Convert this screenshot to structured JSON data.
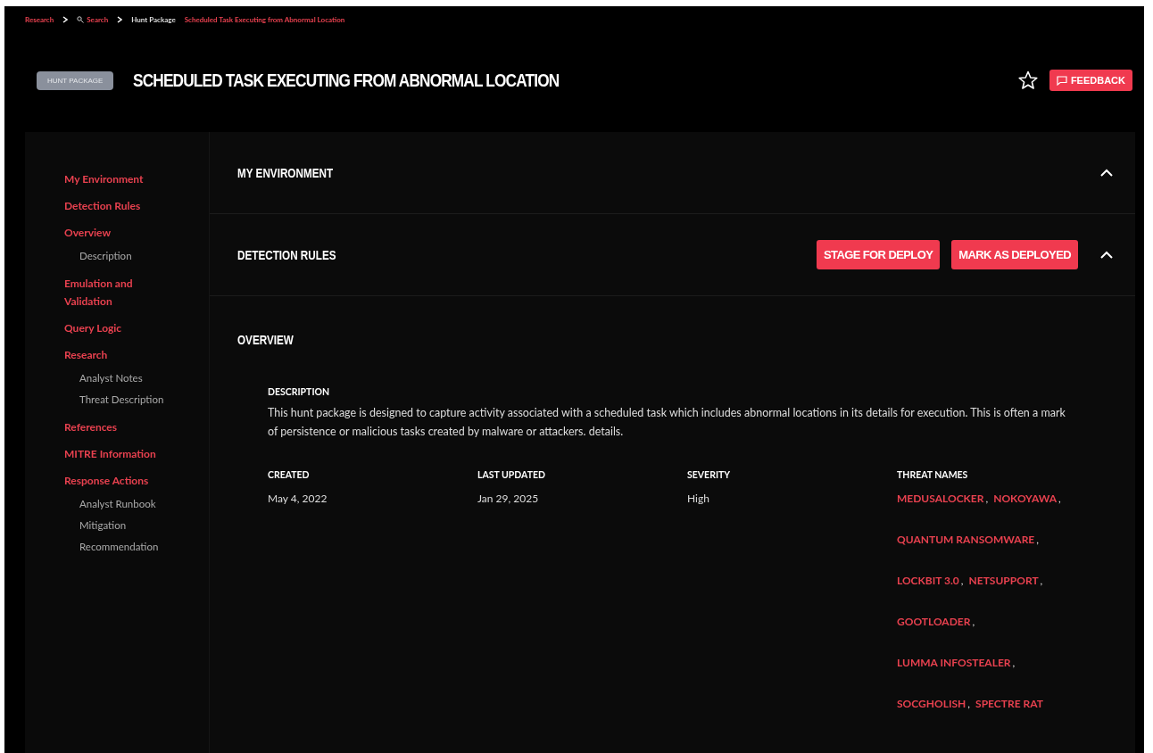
{
  "breadcrumb": [
    {
      "kind": "link",
      "label": "Research"
    },
    {
      "kind": "search",
      "label": "Search"
    },
    {
      "kind": "plain",
      "label": "Hunt Package"
    },
    {
      "kind": "current",
      "label": "Scheduled Task Executing from Abnormal Location"
    }
  ],
  "header": {
    "badge": "HUNT PACKAGE",
    "title": "SCHEDULED TASK EXECUTING FROM ABNORMAL LOCATION",
    "favorite": false,
    "feedback": "FEEDBACK"
  },
  "sidebar": {
    "items": [
      {
        "label": "My Environment"
      },
      {
        "label": "Detection Rules"
      },
      {
        "label": "Overview",
        "children": [
          {
            "label": "Description"
          }
        ]
      },
      {
        "label": "Emulation and Validation"
      },
      {
        "label": "Query Logic"
      },
      {
        "label": "Research",
        "children": [
          {
            "label": "Analyst Notes"
          },
          {
            "label": "Threat Description"
          }
        ]
      },
      {
        "label": "References"
      },
      {
        "label": "MITRE Information"
      },
      {
        "label": "Response Actions",
        "children": [
          {
            "label": "Analyst Runbook"
          },
          {
            "label": "Mitigation"
          },
          {
            "label": "Recommendation"
          }
        ]
      }
    ]
  },
  "sections": [
    {
      "title": "MY ENVIRONMENT",
      "expanded": true
    },
    {
      "title": "DETECTION RULES",
      "expanded": true,
      "actions": [
        "STAGE FOR DEPLOY",
        "MARK AS DEPLOYED"
      ]
    }
  ],
  "overview": {
    "title": "OVERVIEW",
    "description_label": "DESCRIPTION",
    "description": "This hunt package is designed to capture activity associated with a scheduled task which includes abnormal locations in its details for execution. This is often a mark of persistence or malicious tasks created by malware or attackers. details.",
    "fields": [
      {
        "label": "CREATED",
        "value": "May 4, 2022"
      },
      {
        "label": "LAST UPDATED",
        "value": "Jan 29, 2025"
      },
      {
        "label": "SEVERITY",
        "value": "High"
      }
    ],
    "threat_names_label": "THREAT NAMES",
    "threat_rows": [
      [
        {
          "name": "MEDUSALOCKER",
          "separator": ","
        },
        {
          "name": "NOKOYAWA",
          "separator": ","
        }
      ],
      [
        {
          "name": "QUANTUM RANSOMWARE",
          "separator": ","
        }
      ],
      [
        {
          "name": "LOCKBIT 3.0",
          "separator": ","
        },
        {
          "name": "NETSUPPORT",
          "separator": ","
        }
      ],
      [
        {
          "name": "GOOTLOADER",
          "separator": ","
        }
      ],
      [
        {
          "name": "LUMMA INFOSTEALER",
          "separator": ","
        }
      ],
      [
        {
          "name": "SOCGHOLISH",
          "separator": ","
        },
        {
          "name": "SPECTRE RAT"
        }
      ]
    ]
  }
}
